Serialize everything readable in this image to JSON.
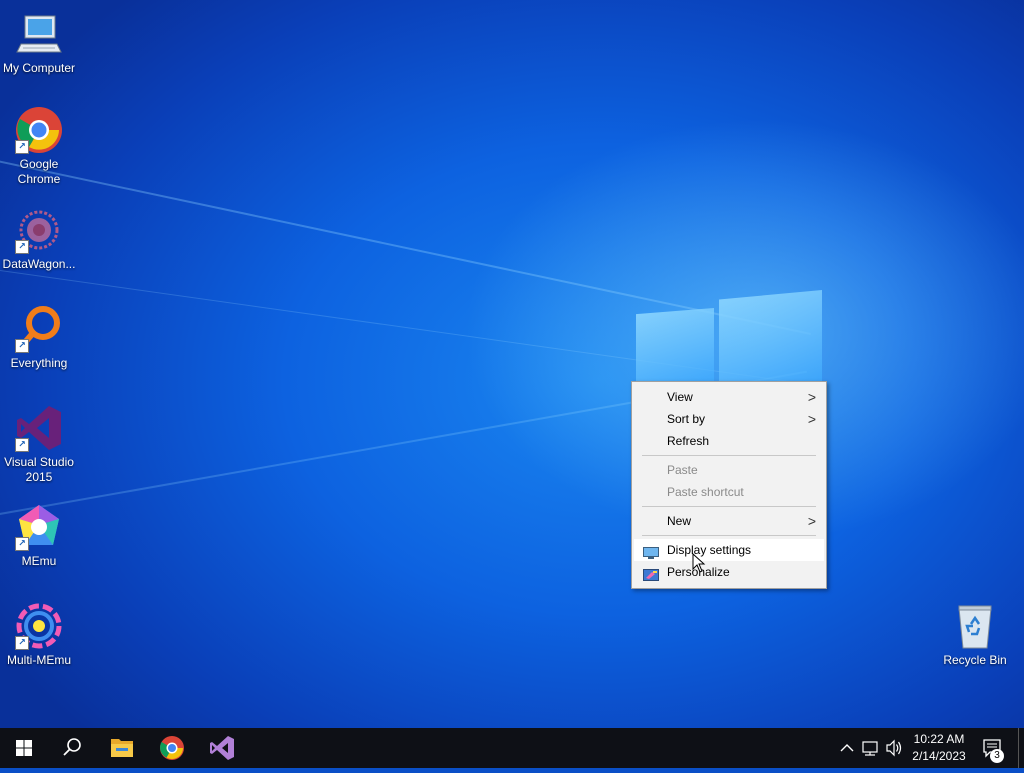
{
  "desktop": {
    "icons": [
      {
        "label": "My Computer",
        "icon": "computer-icon"
      },
      {
        "label": "Google\nChrome",
        "icon": "chrome-icon"
      },
      {
        "label": "DataWagon...",
        "icon": "datawagon-icon"
      },
      {
        "label": "Everything",
        "icon": "everything-search-icon"
      },
      {
        "label": "Visual Studio\n2015",
        "icon": "visual-studio-icon"
      },
      {
        "label": "MEmu",
        "icon": "memu-icon"
      },
      {
        "label": "Multi-MEmu",
        "icon": "multi-memu-icon"
      },
      {
        "label": "Recycle Bin",
        "icon": "recycle-bin-icon"
      }
    ]
  },
  "context_menu": {
    "items": [
      {
        "label": "View",
        "submenu": true,
        "enabled": true
      },
      {
        "label": "Sort by",
        "submenu": true,
        "enabled": true
      },
      {
        "label": "Refresh",
        "submenu": false,
        "enabled": true
      },
      {
        "label": "Paste",
        "submenu": false,
        "enabled": false
      },
      {
        "label": "Paste shortcut",
        "submenu": false,
        "enabled": false
      },
      {
        "label": "New",
        "submenu": true,
        "enabled": true
      },
      {
        "label": "Display settings",
        "submenu": false,
        "enabled": true,
        "highlighted": true,
        "icon": "display-icon"
      },
      {
        "label": "Personalize",
        "submenu": false,
        "enabled": true,
        "icon": "personalize-icon"
      }
    ],
    "submenu_glyph": ">"
  },
  "taskbar": {
    "pinned": [
      {
        "name": "start",
        "icon": "windows-start-icon"
      },
      {
        "name": "search",
        "icon": "search-icon"
      },
      {
        "name": "file-explorer",
        "icon": "folder-icon"
      },
      {
        "name": "chrome",
        "icon": "chrome-icon"
      },
      {
        "name": "visual-studio",
        "icon": "visual-studio-icon"
      }
    ],
    "tray": {
      "icons": [
        "chevron-up-icon",
        "network-icon",
        "volume-icon"
      ],
      "time": "10:22 AM",
      "date": "2/14/2023",
      "notification_count": "3"
    }
  },
  "colors": {
    "taskbar": "#0e1016",
    "menu_bg": "#f2f2f2",
    "menu_highlight": "#ffffff",
    "disabled_text": "#8a8a8a"
  }
}
